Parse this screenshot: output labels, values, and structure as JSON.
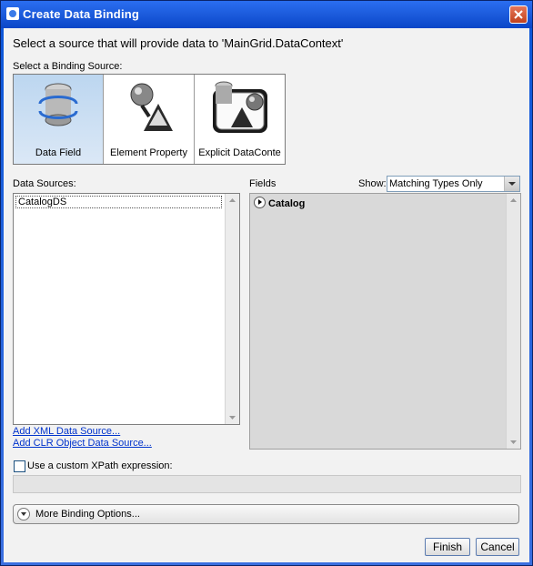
{
  "window": {
    "title": "Create Data Binding"
  },
  "headline": "Select a source that will provide data to 'MainGrid.DataContext'",
  "binding_source": {
    "label": "Select a Binding Source:",
    "options": [
      {
        "label": "Data Field",
        "icon": "data-field-icon",
        "selected": true
      },
      {
        "label": "Element Property",
        "icon": "element-property-icon",
        "selected": false
      },
      {
        "label": "Explicit DataConte",
        "icon": "explicit-datacontext-icon",
        "selected": false
      }
    ]
  },
  "data_sources": {
    "label": "Data Sources:",
    "items": [
      "CatalogDS"
    ],
    "links": [
      "Add XML Data Source...",
      "Add CLR Object Data Source..."
    ]
  },
  "fields": {
    "label": "Fields",
    "show_label": "Show:",
    "show_value": "Matching Types Only",
    "tree": [
      "Catalog"
    ]
  },
  "xpath": {
    "checkbox_label": "Use a custom XPath expression:",
    "checked": false,
    "value": ""
  },
  "more_options_label": "More Binding Options...",
  "buttons": {
    "finish": "Finish",
    "cancel": "Cancel"
  },
  "colors": {
    "title_bar": "#1f5fe0",
    "selected_tile": "#c6dcf2",
    "link": "#0033cc"
  }
}
